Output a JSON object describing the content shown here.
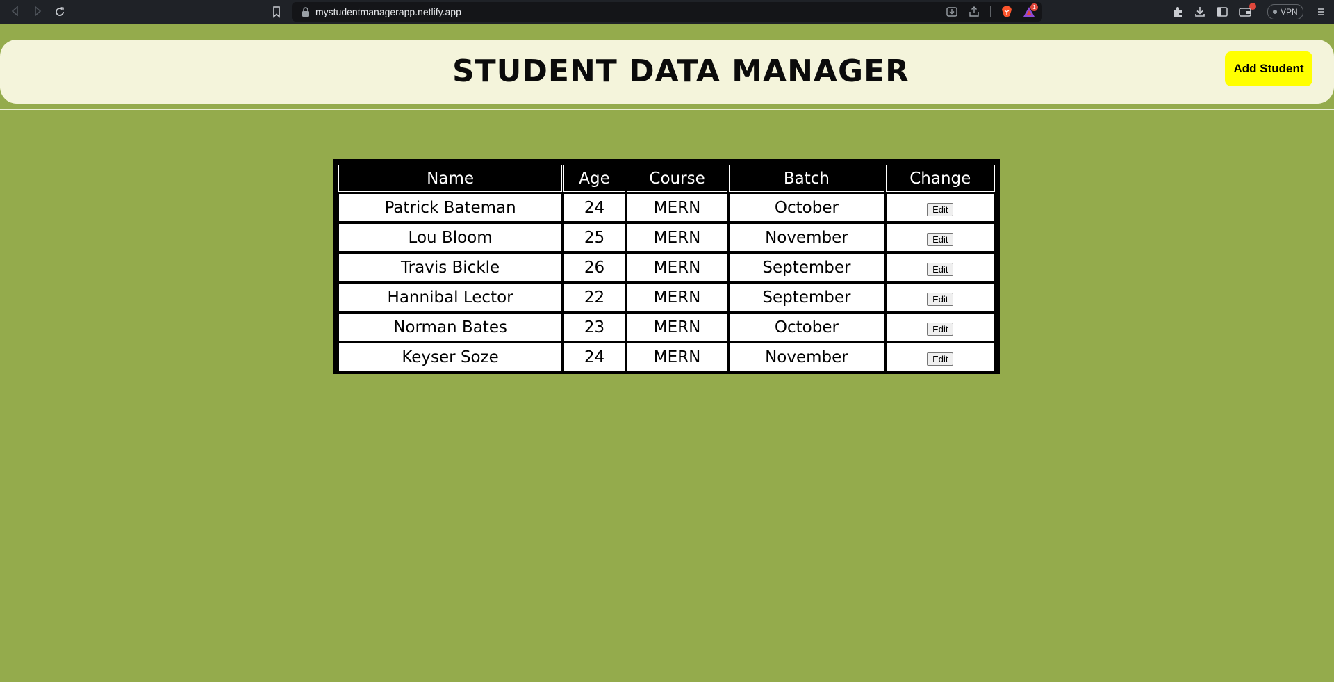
{
  "browser": {
    "url": "mystudentmanagerapp.netlify.app",
    "rewards_count": "1",
    "vpn_label": "VPN",
    "colors": {
      "chrome": "#1f2227",
      "url_bar": "#141518",
      "badge": "#e0473b"
    }
  },
  "header": {
    "title": "STUDENT DATA MANAGER",
    "add_button_label": "Add Student",
    "colors": {
      "background": "#f4f4db",
      "button": "#ffff00"
    }
  },
  "page": {
    "colors": {
      "background": "#94ab4c"
    }
  },
  "table": {
    "columns": [
      "Name",
      "Age",
      "Course",
      "Batch",
      "Change"
    ],
    "rows": [
      {
        "name": "Patrick Bateman",
        "age": "24",
        "course": "MERN",
        "batch": "October",
        "action": "Edit"
      },
      {
        "name": "Lou Bloom",
        "age": "25",
        "course": "MERN",
        "batch": "November",
        "action": "Edit"
      },
      {
        "name": "Travis Bickle",
        "age": "26",
        "course": "MERN",
        "batch": "September",
        "action": "Edit"
      },
      {
        "name": "Hannibal Lector",
        "age": "22",
        "course": "MERN",
        "batch": "September",
        "action": "Edit"
      },
      {
        "name": "Norman Bates",
        "age": "23",
        "course": "MERN",
        "batch": "October",
        "action": "Edit"
      },
      {
        "name": "Keyser Soze",
        "age": "24",
        "course": "MERN",
        "batch": "November",
        "action": "Edit"
      }
    ]
  }
}
